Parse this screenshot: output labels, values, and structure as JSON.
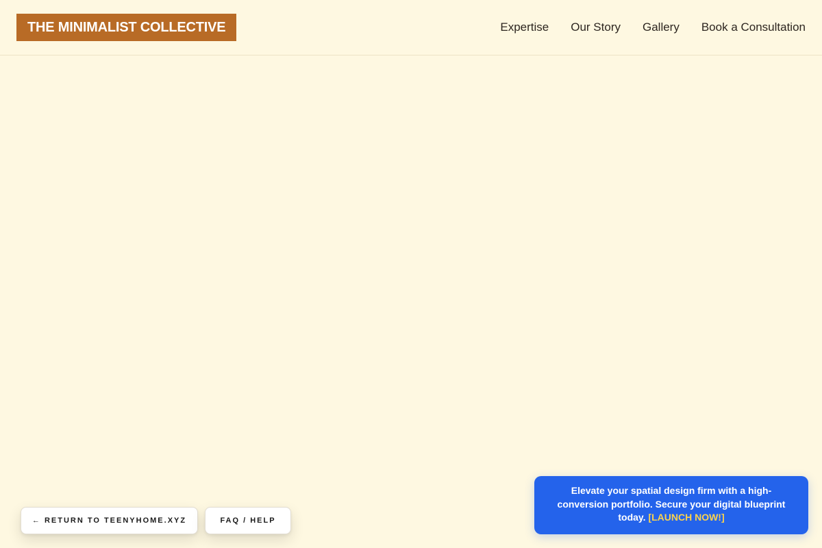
{
  "header": {
    "logo": "THE MINIMALIST COLLECTIVE",
    "nav": [
      {
        "label": "Expertise"
      },
      {
        "label": "Our Story"
      },
      {
        "label": "Gallery"
      },
      {
        "label": "Book a Consultation"
      }
    ]
  },
  "floating": {
    "return_label": "← RETURN TO TEENYHOME.XYZ",
    "faq_label": "FAQ / HELP"
  },
  "promo": {
    "text": "Elevate your spatial design firm with a high-conversion portfolio. Secure your digital blueprint today.",
    "cta": "[LAUNCH NOW!]"
  },
  "colors": {
    "background": "#fef8e1",
    "logo_bg": "#b86b26",
    "promo_bg": "#2463eb",
    "promo_cta": "#fcd34d"
  }
}
